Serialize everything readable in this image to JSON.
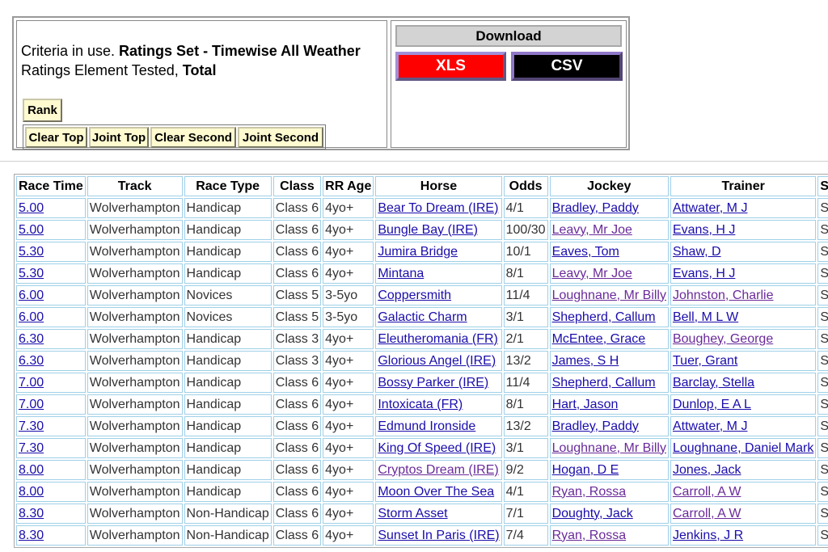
{
  "criteria": {
    "prefix": "Criteria in use. ",
    "ratings_set": "Ratings Set - Timewise All Weather",
    "element_prefix": "Ratings Element Tested, ",
    "element": "Total"
  },
  "buttons": {
    "rank": "Rank",
    "clear_top": "Clear Top",
    "joint_top": "Joint Top",
    "clear_second": "Clear Second",
    "joint_second": "Joint Second"
  },
  "download": {
    "header": "Download",
    "xls": "XLS",
    "csv": "CSV",
    "colors": {
      "xls": "#ff0000",
      "csv": "#000000"
    }
  },
  "table": {
    "headers": [
      "Race Time",
      "Track",
      "Race Type",
      "Class",
      "RR Age",
      "Horse",
      "Odds",
      "Jockey",
      "Trainer",
      "S"
    ],
    "rows": [
      {
        "time": "5.00",
        "track": "Wolverhampton",
        "race_type": "Handicap",
        "class": "Class 6",
        "age": "4yo+",
        "horse": "Bear To Dream (IRE)",
        "odds": "4/1",
        "jockey": "Bradley, Paddy",
        "trainer": "Attwater, M J",
        "extra": "S",
        "visited": {
          "horse": false,
          "jockey": false,
          "trainer": false
        }
      },
      {
        "time": "5.00",
        "track": "Wolverhampton",
        "race_type": "Handicap",
        "class": "Class 6",
        "age": "4yo+",
        "horse": "Bungle Bay (IRE)",
        "odds": "100/30",
        "jockey": "Leavy, Mr Joe",
        "trainer": "Evans, H J",
        "extra": "S",
        "visited": {
          "horse": false,
          "jockey": true,
          "trainer": false
        }
      },
      {
        "time": "5.30",
        "track": "Wolverhampton",
        "race_type": "Handicap",
        "class": "Class 6",
        "age": "4yo+",
        "horse": "Jumira Bridge",
        "odds": "10/1",
        "jockey": "Eaves, Tom",
        "trainer": "Shaw, D",
        "extra": "S",
        "visited": {
          "horse": false,
          "jockey": false,
          "trainer": false
        }
      },
      {
        "time": "5.30",
        "track": "Wolverhampton",
        "race_type": "Handicap",
        "class": "Class 6",
        "age": "4yo+",
        "horse": "Mintana",
        "odds": "8/1",
        "jockey": "Leavy, Mr Joe",
        "trainer": "Evans, H J",
        "extra": "S",
        "visited": {
          "horse": false,
          "jockey": true,
          "trainer": false
        }
      },
      {
        "time": "6.00",
        "track": "Wolverhampton",
        "race_type": "Novices",
        "class": "Class 5",
        "age": "3-5yo",
        "horse": "Coppersmith",
        "odds": "11/4",
        "jockey": "Loughnane, Mr Billy",
        "trainer": "Johnston, Charlie",
        "extra": "S",
        "visited": {
          "horse": false,
          "jockey": true,
          "trainer": true
        }
      },
      {
        "time": "6.00",
        "track": "Wolverhampton",
        "race_type": "Novices",
        "class": "Class 5",
        "age": "3-5yo",
        "horse": "Galactic Charm",
        "odds": "3/1",
        "jockey": "Shepherd, Callum",
        "trainer": "Bell, M L W",
        "extra": "S",
        "visited": {
          "horse": false,
          "jockey": false,
          "trainer": false
        }
      },
      {
        "time": "6.30",
        "track": "Wolverhampton",
        "race_type": "Handicap",
        "class": "Class 3",
        "age": "4yo+",
        "horse": "Eleutheromania (FR)",
        "odds": "2/1",
        "jockey": "McEntee, Grace",
        "trainer": "Boughey, George",
        "extra": "S",
        "visited": {
          "horse": false,
          "jockey": false,
          "trainer": true
        }
      },
      {
        "time": "6.30",
        "track": "Wolverhampton",
        "race_type": "Handicap",
        "class": "Class 3",
        "age": "4yo+",
        "horse": "Glorious Angel (IRE)",
        "odds": "13/2",
        "jockey": "James, S H",
        "trainer": "Tuer, Grant",
        "extra": "S",
        "visited": {
          "horse": false,
          "jockey": false,
          "trainer": false
        }
      },
      {
        "time": "7.00",
        "track": "Wolverhampton",
        "race_type": "Handicap",
        "class": "Class 6",
        "age": "4yo+",
        "horse": "Bossy Parker (IRE)",
        "odds": "11/4",
        "jockey": "Shepherd, Callum",
        "trainer": "Barclay, Stella",
        "extra": "S",
        "visited": {
          "horse": false,
          "jockey": false,
          "trainer": false
        }
      },
      {
        "time": "7.00",
        "track": "Wolverhampton",
        "race_type": "Handicap",
        "class": "Class 6",
        "age": "4yo+",
        "horse": "Intoxicata (FR)",
        "odds": "8/1",
        "jockey": "Hart, Jason",
        "trainer": "Dunlop, E A L",
        "extra": "S",
        "visited": {
          "horse": false,
          "jockey": false,
          "trainer": false
        }
      },
      {
        "time": "7.30",
        "track": "Wolverhampton",
        "race_type": "Handicap",
        "class": "Class 6",
        "age": "4yo+",
        "horse": "Edmund Ironside",
        "odds": "13/2",
        "jockey": "Bradley, Paddy",
        "trainer": "Attwater, M J",
        "extra": "S",
        "visited": {
          "horse": false,
          "jockey": false,
          "trainer": false
        }
      },
      {
        "time": "7.30",
        "track": "Wolverhampton",
        "race_type": "Handicap",
        "class": "Class 6",
        "age": "4yo+",
        "horse": "King Of Speed (IRE)",
        "odds": "3/1",
        "jockey": "Loughnane, Mr Billy",
        "trainer": "Loughnane, Daniel Mark",
        "extra": "S",
        "visited": {
          "horse": false,
          "jockey": true,
          "trainer": false
        }
      },
      {
        "time": "8.00",
        "track": "Wolverhampton",
        "race_type": "Handicap",
        "class": "Class 6",
        "age": "4yo+",
        "horse": "Cryptos Dream (IRE)",
        "odds": "9/2",
        "jockey": "Hogan, D E",
        "trainer": "Jones, Jack",
        "extra": "S",
        "visited": {
          "horse": true,
          "jockey": false,
          "trainer": false
        }
      },
      {
        "time": "8.00",
        "track": "Wolverhampton",
        "race_type": "Handicap",
        "class": "Class 6",
        "age": "4yo+",
        "horse": "Moon Over The Sea",
        "odds": "4/1",
        "jockey": "Ryan, Rossa",
        "trainer": "Carroll, A W",
        "extra": "S",
        "visited": {
          "horse": false,
          "jockey": true,
          "trainer": true
        }
      },
      {
        "time": "8.30",
        "track": "Wolverhampton",
        "race_type": "Non-Handicap",
        "class": "Class 6",
        "age": "4yo+",
        "horse": "Storm Asset",
        "odds": "7/1",
        "jockey": "Doughty, Jack",
        "trainer": "Carroll, A W",
        "extra": "S",
        "visited": {
          "horse": false,
          "jockey": false,
          "trainer": true
        }
      },
      {
        "time": "8.30",
        "track": "Wolverhampton",
        "race_type": "Non-Handicap",
        "class": "Class 6",
        "age": "4yo+",
        "horse": "Sunset In Paris (IRE)",
        "odds": "7/4",
        "jockey": "Ryan, Rossa",
        "trainer": "Jenkins, J R",
        "extra": "S",
        "visited": {
          "horse": false,
          "jockey": true,
          "trainer": false
        }
      }
    ]
  }
}
